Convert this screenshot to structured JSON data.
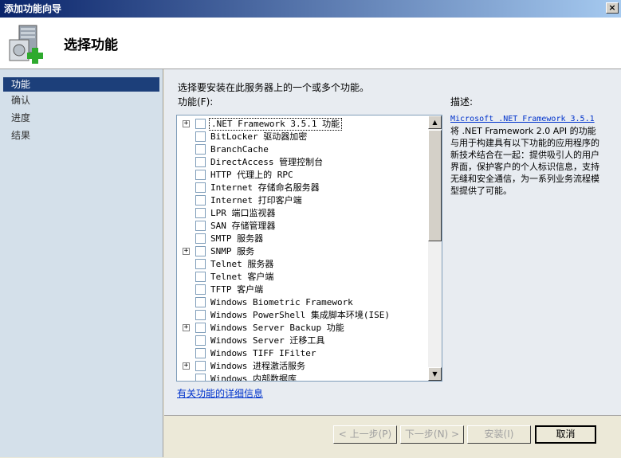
{
  "window": {
    "title": "添加功能向导",
    "close_label": "×"
  },
  "header": {
    "title": "选择功能",
    "icon": "server-add-icon"
  },
  "sidebar": {
    "items": [
      {
        "label": "功能",
        "active": true
      },
      {
        "label": "确认",
        "active": false
      },
      {
        "label": "进度",
        "active": false
      },
      {
        "label": "结果",
        "active": false
      }
    ]
  },
  "main": {
    "instructions": "选择要安装在此服务器上的一个或多个功能。",
    "features_label": "功能(F):",
    "description_label": "描述:",
    "more_info_link": "有关功能的详细信息",
    "features": [
      {
        "label": ".NET Framework 3.5.1 功能",
        "expandable": true,
        "selected": true
      },
      {
        "label": "BitLocker 驱动器加密",
        "expandable": false
      },
      {
        "label": "BranchCache",
        "expandable": false
      },
      {
        "label": "DirectAccess 管理控制台",
        "expandable": false
      },
      {
        "label": "HTTP 代理上的 RPC",
        "expandable": false
      },
      {
        "label": "Internet 存储命名服务器",
        "expandable": false
      },
      {
        "label": "Internet 打印客户端",
        "expandable": false
      },
      {
        "label": "LPR 端口监视器",
        "expandable": false
      },
      {
        "label": "SAN 存储管理器",
        "expandable": false
      },
      {
        "label": "SMTP 服务器",
        "expandable": false
      },
      {
        "label": "SNMP 服务",
        "expandable": true
      },
      {
        "label": "Telnet 服务器",
        "expandable": false
      },
      {
        "label": "Telnet 客户端",
        "expandable": false
      },
      {
        "label": "TFTP 客户端",
        "expandable": false
      },
      {
        "label": "Windows Biometric Framework",
        "expandable": false
      },
      {
        "label": "Windows PowerShell 集成脚本环境(ISE)",
        "expandable": false
      },
      {
        "label": "Windows Server Backup 功能",
        "expandable": true
      },
      {
        "label": "Windows Server 迁移工具",
        "expandable": false
      },
      {
        "label": "Windows TIFF IFilter",
        "expandable": false
      },
      {
        "label": "Windows 进程激活服务",
        "expandable": true
      },
      {
        "label": "Windows 内部数据库",
        "expandable": false
      }
    ],
    "description": {
      "link": "Microsoft .NET Framework 3.5.1",
      "text": "将 .NET Framework 2.0 API 的功能与用于构建具有以下功能的应用程序的新技术结合在一起：提供吸引人的用户界面，保护客户的个人标识信息，支持无缝和安全通信，为一系列业务流程模型提供了可能。"
    }
  },
  "footer": {
    "prev": "< 上一步(P)",
    "next": "下一步(N) >",
    "install": "安装(I)",
    "cancel": "取消"
  },
  "scroll": {
    "up_icon": "▲",
    "down_icon": "▼"
  },
  "colors": {
    "accent": "#1c3f7a",
    "title_gradient_start": "#0a246a",
    "link": "#0033cc"
  }
}
